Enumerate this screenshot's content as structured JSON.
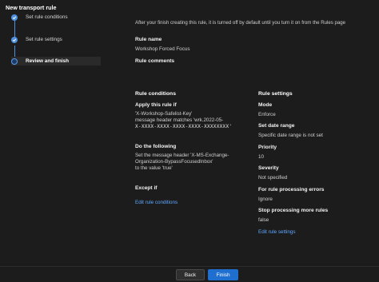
{
  "wizard": {
    "title": "New transport rule",
    "steps": [
      {
        "label": "Set rule conditions",
        "state": "complete"
      },
      {
        "label": "Set rule settings",
        "state": "complete"
      },
      {
        "label": "Review and finish",
        "state": "current"
      }
    ]
  },
  "intro_text": "After your finish creating this rule, it is turned off by default until you turn it on from the Rules page",
  "rule": {
    "name_label": "Rule name",
    "name_value": "Workshop Forced Focus",
    "comments_label": "Rule comments",
    "comments_value": ""
  },
  "conditions": {
    "title": "Rule conditions",
    "apply_label": "Apply this rule if",
    "apply_lines": [
      "'X-Workshop-Safelist-Key'",
      " message header matches  'wrk.2022-05-",
      "X-XXXX-XXXX-XXXX-XXXX-XXXXXXXX'"
    ],
    "do_label": "Do the following",
    "do_lines": [
      "Set the message header  'X-MS-Exchange-",
      "Organization-BypassFocusedInbox'",
      " to the value  'true'"
    ],
    "except_label": "Except if",
    "edit_link": "Edit rule conditions"
  },
  "settings": {
    "title": "Rule settings",
    "items": [
      {
        "label": "Mode",
        "value": "Enforce"
      },
      {
        "label": "Set date range",
        "value": "Specific date range is not set"
      },
      {
        "label": "Priority",
        "value": "10"
      },
      {
        "label": "Severity",
        "value": "Not specified"
      },
      {
        "label": "For rule processing errors",
        "value": "Ignore"
      },
      {
        "label": "Stop processing more rules",
        "value": "false"
      }
    ],
    "edit_link": "Edit rule settings"
  },
  "footer": {
    "back_label": "Back",
    "finish_label": "Finish"
  },
  "colors": {
    "accent": "#1f6fd1",
    "link": "#5fa8ff",
    "background": "#1c1c1c"
  }
}
